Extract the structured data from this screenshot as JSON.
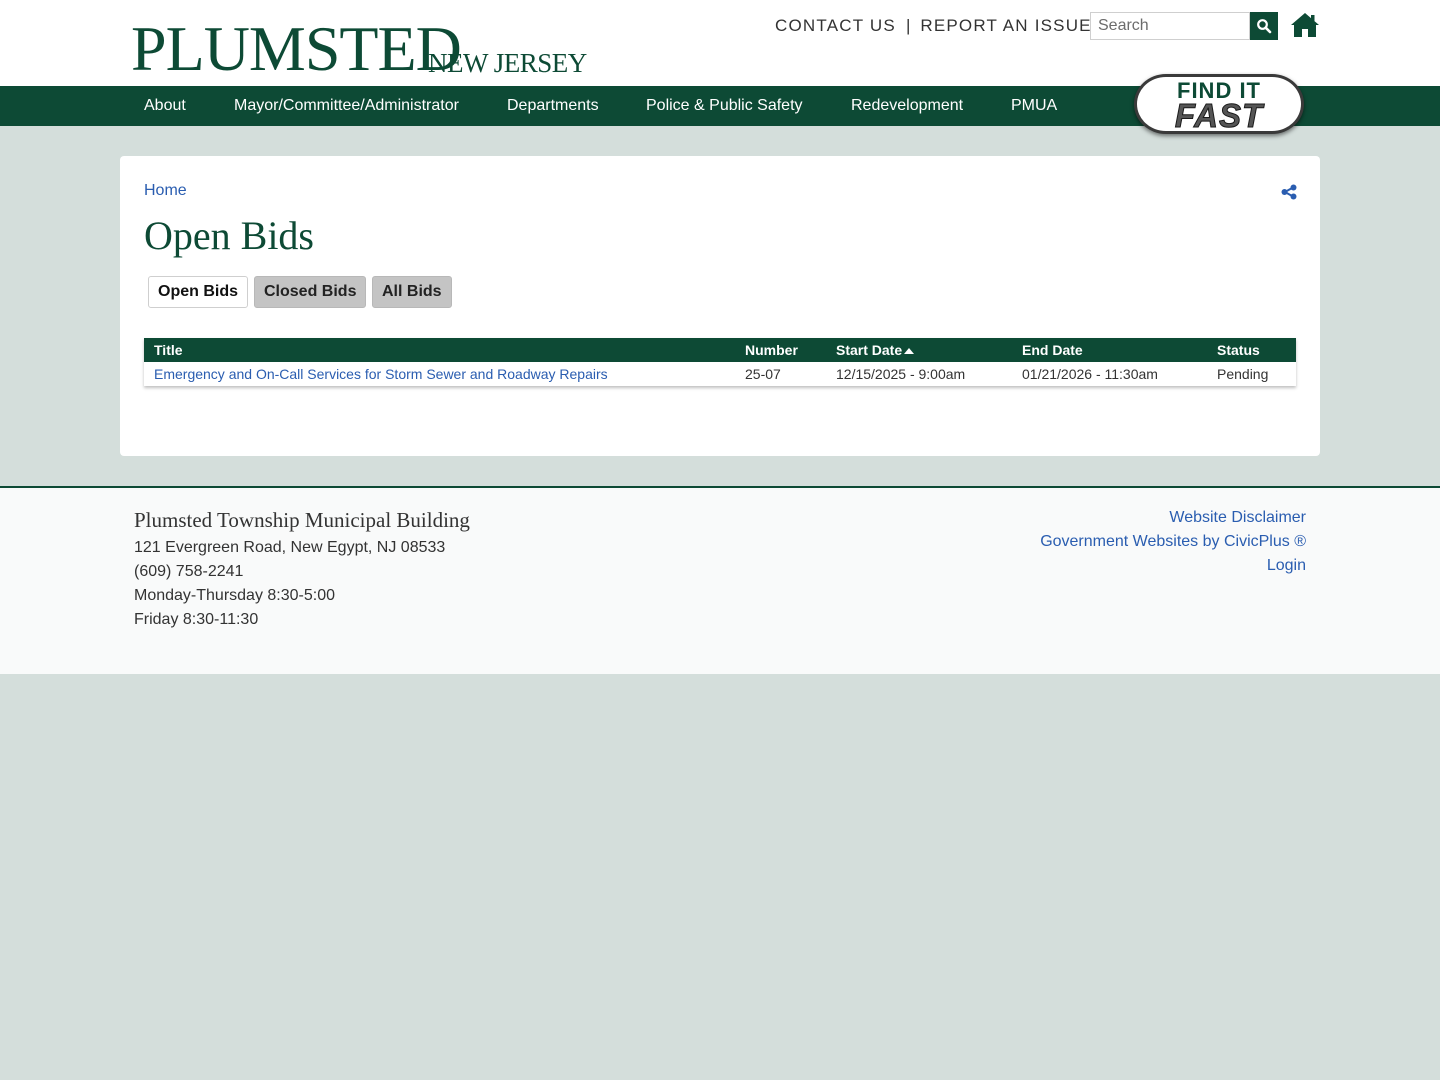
{
  "header": {
    "logo_main": "PLUMSTED",
    "logo_sub": "NEW JERSEY",
    "contact_label": "CONTACT US",
    "separator": "|",
    "report_label": "REPORT AN ISSUE",
    "search_placeholder": "Search",
    "search_icon": "search-icon",
    "home_icon": "home-icon"
  },
  "nav": {
    "items": [
      "About",
      "Mayor/Committee/Administrator",
      "Departments",
      "Police & Public Safety",
      "Redevelopment",
      "PMUA"
    ],
    "find_it_line1": "FIND IT",
    "find_it_line2": "FAST"
  },
  "main": {
    "breadcrumb": "Home",
    "title": "Open Bids",
    "share_icon": "share-icon",
    "tabs": [
      "Open Bids",
      "Closed Bids",
      "All Bids"
    ],
    "active_tab": "Open Bids",
    "table": {
      "columns": [
        "Title",
        "Number",
        "Start Date",
        "End Date",
        "Status"
      ],
      "sorted_column": "Start Date",
      "rows": [
        {
          "title": "Emergency and On-Call Services for Storm Sewer and Roadway Repairs",
          "number": "25-07",
          "start": "12/15/2025 - 9:00am",
          "end": "01/21/2026 - 11:30am",
          "status": "Pending"
        }
      ]
    }
  },
  "footer": {
    "title": "Plumsted Township Municipal Building",
    "address": "121 Evergreen Road, New Egypt, NJ 08533",
    "phone": "(609) 758-2241",
    "hours1": "Monday-Thursday 8:30-5:00",
    "hours2": "Friday 8:30-11:30",
    "links": [
      "Website Disclaimer",
      "Government Websites by CivicPlus ®",
      "Login"
    ]
  },
  "colors": {
    "brand_green": "#0d4a35",
    "link_blue": "#2a5db0",
    "page_bg": "#d4dedb"
  }
}
